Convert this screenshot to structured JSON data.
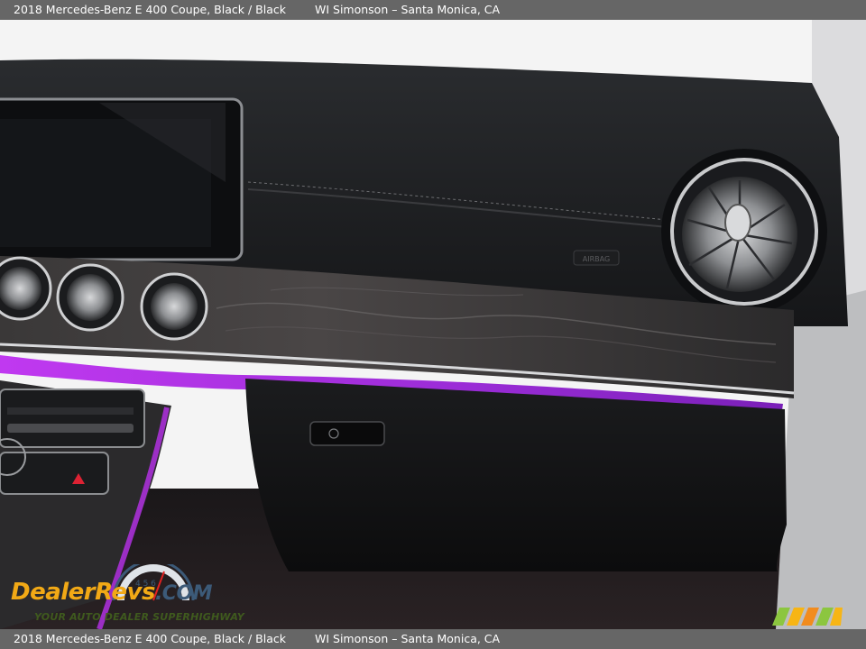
{
  "header": {
    "title": "2018 Mercedes-Benz E 400 Coupe,  Black / Black",
    "dealer": "WI Simonson – Santa Monica, CA"
  },
  "footer": {
    "title": "2018 Mercedes-Benz E 400 Coupe,  Black / Black",
    "dealer": "WI Simonson – Santa Monica, CA"
  },
  "photo": {
    "airbag_label": "AIRBAG"
  },
  "watermark": {
    "brand_part1": "Dealer",
    "brand_part2": "Revs",
    "brand_part3": ".COM",
    "tagline": "YOUR AUTO DEALER SUPERHIGHWAY",
    "gauge_digits": "4 5 6"
  },
  "colors": {
    "bar_background": "#666666",
    "ambient_light": "#b030e0",
    "brand_orange": "#f2a916",
    "brand_blue": "#3c5a78",
    "tagline_green": "#3f5a1e"
  }
}
